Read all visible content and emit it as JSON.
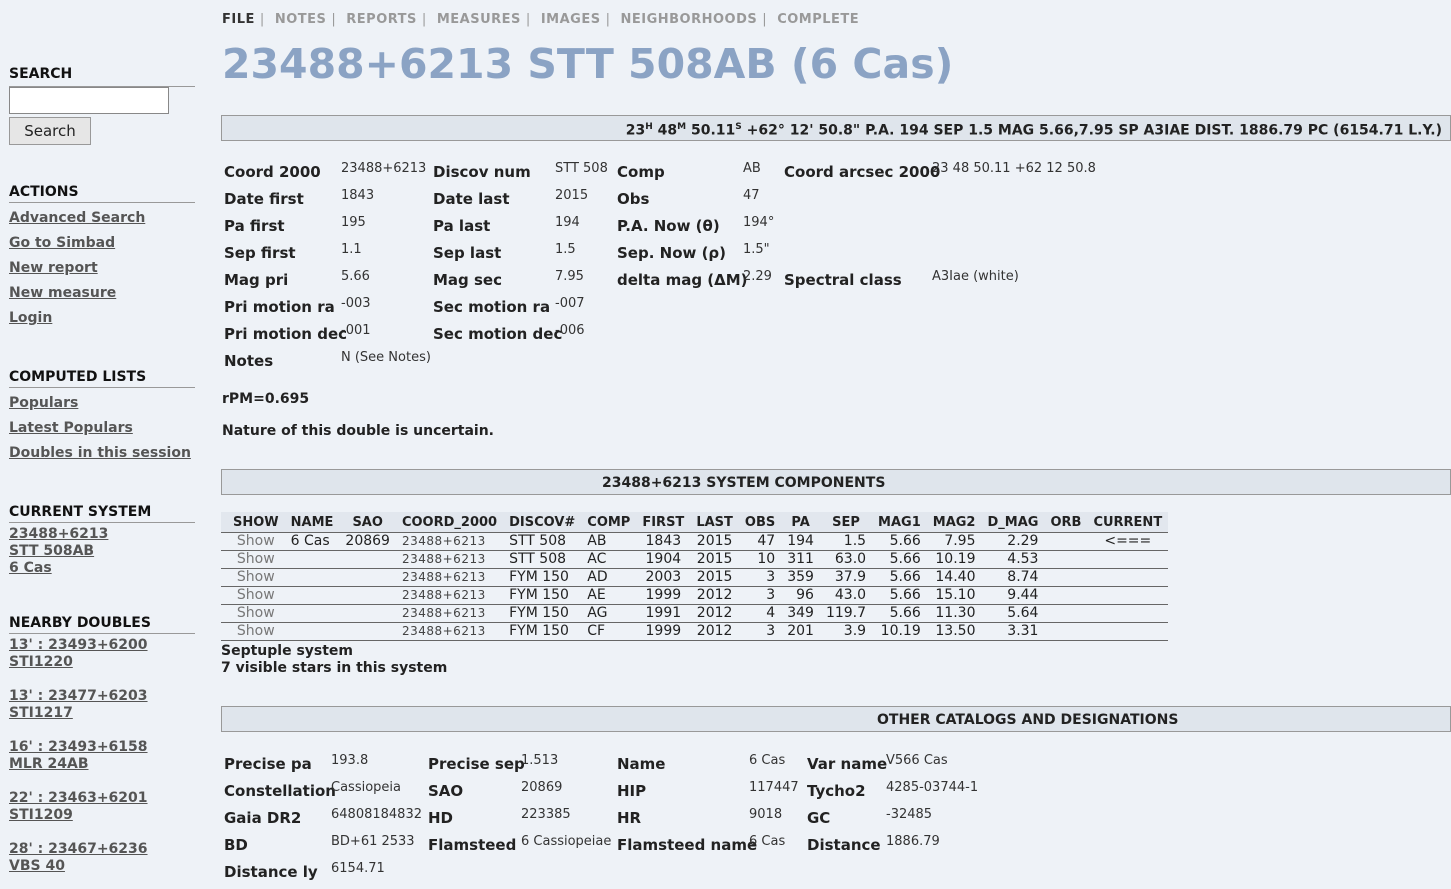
{
  "nav": {
    "items": [
      "FILE",
      "NOTES",
      "REPORTS",
      "MEASURES",
      "IMAGES",
      "NEIGHBORHOODS",
      "COMPLETE"
    ],
    "active": "FILE"
  },
  "sidebar": {
    "search_heading": "SEARCH",
    "search_value": "",
    "search_button": "Search",
    "actions_heading": "ACTIONS",
    "actions": [
      "Advanced Search",
      "Go to Simbad",
      "New report",
      "New measure",
      "Login"
    ],
    "computed_heading": "COMPUTED LISTS",
    "computed": [
      "Populars",
      "Latest Populars",
      "Doubles in this session"
    ],
    "current_heading": "CURRENT SYSTEM",
    "current": [
      "23488+6213",
      "STT 508AB",
      "6 Cas"
    ],
    "nearby_heading": "NEARBY DOUBLES",
    "nearby": [
      {
        "line1": "13' : 23493+6200",
        "line2": "STI1220"
      },
      {
        "line1": "13' : 23477+6203",
        "line2": "STI1217"
      },
      {
        "line1": "16' : 23493+6158",
        "line2": "MLR 24AB"
      },
      {
        "line1": "22' : 23463+6201",
        "line2": "STI1209"
      },
      {
        "line1": "28' : 23467+6236",
        "line2": "VBS 40"
      }
    ]
  },
  "title": "23488+6213 STT 508AB (6 Cas)",
  "summary": {
    "ra_h": "23",
    "ra_m": "48",
    "ra_s": "50.11",
    "h_sup": "H",
    "m_sup": "M",
    "s_sup": "S",
    "rest": "+62° 12' 50.8\" P.A. 194 SEP 1.5 MAG 5.66,7.95 SP A3IAE DIST. 1886.79 PC (6154.71 L.Y.)"
  },
  "details": {
    "coord2000": {
      "label": "Coord 2000",
      "value": "23488+6213"
    },
    "discov_num": {
      "label": "Discov num",
      "value": "STT 508"
    },
    "comp": {
      "label": "Comp",
      "value": "AB"
    },
    "coord_arcsec": {
      "label": "Coord arcsec 2000",
      "value": "23 48 50.11 +62 12 50.8"
    },
    "date_first": {
      "label": "Date first",
      "value": "1843"
    },
    "date_last": {
      "label": "Date last",
      "value": "2015"
    },
    "obs": {
      "label": "Obs",
      "value": "47"
    },
    "pa_first": {
      "label": "Pa first",
      "value": "195"
    },
    "pa_last": {
      "label": "Pa last",
      "value": "194"
    },
    "pa_now": {
      "label": "P.A. Now (θ)",
      "value": "194°"
    },
    "sep_first": {
      "label": "Sep first",
      "value": "1.1"
    },
    "sep_last": {
      "label": "Sep last",
      "value": "1.5"
    },
    "sep_now": {
      "label": "Sep. Now (ρ)",
      "value": "1.5\""
    },
    "mag_pri": {
      "label": "Mag pri",
      "value": "5.66"
    },
    "mag_sec": {
      "label": "Mag sec",
      "value": "7.95"
    },
    "delta_mag": {
      "label": "delta mag (ΔM)",
      "value": "2.29"
    },
    "spectral": {
      "label": "Spectral class",
      "value": "A3Iae (white)"
    },
    "pri_ra": {
      "label": "Pri motion ra",
      "value": "-003"
    },
    "sec_ra": {
      "label": "Sec motion ra",
      "value": "-007"
    },
    "pri_dec": {
      "label": "Pri motion dec",
      "value": "-001"
    },
    "sec_dec": {
      "label": "Sec motion dec",
      "value": "-006"
    },
    "notes": {
      "label": "Notes",
      "value": "N (See Notes)"
    }
  },
  "rpm": "rPM=0.695",
  "nature": "Nature of this double is uncertain.",
  "components": {
    "heading": "23488+6213 SYSTEM COMPONENTS",
    "columns": [
      "SHOW",
      "NAME",
      "SAO",
      "COORD_2000",
      "DISCOV#",
      "COMP",
      "FIRST",
      "LAST",
      "OBS",
      "PA",
      "SEP",
      "MAG1",
      "MAG2",
      "D_MAG",
      "ORB",
      "CURRENT"
    ],
    "rows": [
      [
        "Show",
        "6 Cas",
        "20869",
        "23488+6213",
        "STT 508",
        "AB",
        "1843",
        "2015",
        "47",
        "194",
        "1.5",
        "5.66",
        "7.95",
        "2.29",
        "",
        "<==="
      ],
      [
        "Show",
        "",
        "",
        "23488+6213",
        "STT 508",
        "AC",
        "1904",
        "2015",
        "10",
        "311",
        "63.0",
        "5.66",
        "10.19",
        "4.53",
        "",
        ""
      ],
      [
        "Show",
        "",
        "",
        "23488+6213",
        "FYM 150",
        "AD",
        "2003",
        "2015",
        "3",
        "359",
        "37.9",
        "5.66",
        "14.40",
        "8.74",
        "",
        ""
      ],
      [
        "Show",
        "",
        "",
        "23488+6213",
        "FYM 150",
        "AE",
        "1999",
        "2012",
        "3",
        "96",
        "43.0",
        "5.66",
        "15.10",
        "9.44",
        "",
        ""
      ],
      [
        "Show",
        "",
        "",
        "23488+6213",
        "FYM 150",
        "AG",
        "1991",
        "2012",
        "4",
        "349",
        "119.7",
        "5.66",
        "11.30",
        "5.64",
        "",
        ""
      ],
      [
        "Show",
        "",
        "",
        "23488+6213",
        "FYM 150",
        "CF",
        "1999",
        "2012",
        "3",
        "201",
        "3.9",
        "10.19",
        "13.50",
        "3.31",
        "",
        ""
      ]
    ],
    "system_type": "Septuple system",
    "visible_stars": "7 visible stars in this system"
  },
  "catalogs": {
    "heading": "OTHER CATALOGS AND DESIGNATIONS",
    "precise_pa": {
      "label": "Precise pa",
      "value": "193.8"
    },
    "precise_sep": {
      "label": "Precise sep",
      "value": "1.513"
    },
    "name": {
      "label": "Name",
      "value": "6 Cas"
    },
    "var_name": {
      "label": "Var name",
      "value": "V566 Cas"
    },
    "constellation": {
      "label": "Constellation",
      "value": "Cassiopeia"
    },
    "sao": {
      "label": "SAO",
      "value": "20869"
    },
    "hip": {
      "label": "HIP",
      "value": "117447"
    },
    "tycho2": {
      "label": "Tycho2",
      "value": "4285-03744-1"
    },
    "gaia": {
      "label": "Gaia DR2",
      "value": "64808184832"
    },
    "hd": {
      "label": "HD",
      "value": "223385"
    },
    "hr": {
      "label": "HR",
      "value": "9018"
    },
    "gc": {
      "label": "GC",
      "value": "-32485"
    },
    "bd": {
      "label": "BD",
      "value": "BD+61 2533"
    },
    "flamsteed": {
      "label": "Flamsteed",
      "value": "6 Cassiopeiae"
    },
    "flamsteed_name": {
      "label": "Flamsteed name",
      "value": "6 Cas"
    },
    "distance": {
      "label": "Distance",
      "value": "1886.79"
    },
    "distance_ly": {
      "label": "Distance ly",
      "value": "6154.71"
    }
  }
}
